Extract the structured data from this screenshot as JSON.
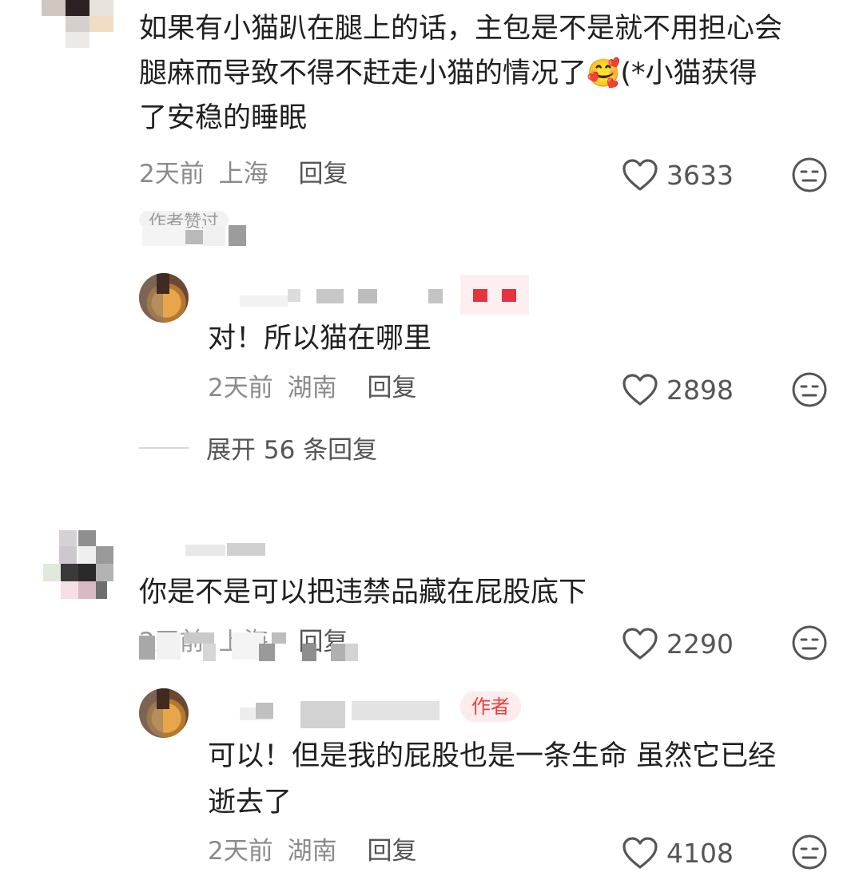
{
  "comments": [
    {
      "text_lines": [
        "如果有小猫趴在腿上的话，主包是不是就不用担心会",
        "腿麻而导致不得不赶走小猫的情况了",
        "了安稳的睡眠"
      ],
      "text_line2_tail": "(*小猫获得",
      "emoji": "🥰",
      "time": "2天前",
      "location": "上海",
      "reply_label": "回复",
      "likes": "3633",
      "author_liked_label": "作者赞过",
      "reply": {
        "text": "对！所以猫在哪里",
        "time": "2天前",
        "location": "湖南",
        "reply_label": "回复",
        "likes": "2898"
      },
      "expand_label": "展开 56 条回复"
    },
    {
      "text_lines": [
        "你是不是可以把违禁品藏在屁股底下"
      ],
      "time": "2天前",
      "location": "上海",
      "reply_label": "回复",
      "likes": "2290",
      "reply": {
        "author_badge": "作者",
        "text_lines": [
          "可以！但是我的屁股也是一条生命 虽然它已经",
          "逝去了"
        ],
        "time": "2天前",
        "location": "湖南",
        "reply_label": "回复",
        "likes": "4108"
      }
    }
  ],
  "colors": {
    "text": "#202020",
    "meta": "#8a8a8a",
    "icon": "#555555",
    "author_badge_bg": "#fdecec",
    "author_badge_text": "#e8403d"
  },
  "icons": {
    "like": "heart-outline-icon",
    "dislike": "neutral-face-icon"
  }
}
